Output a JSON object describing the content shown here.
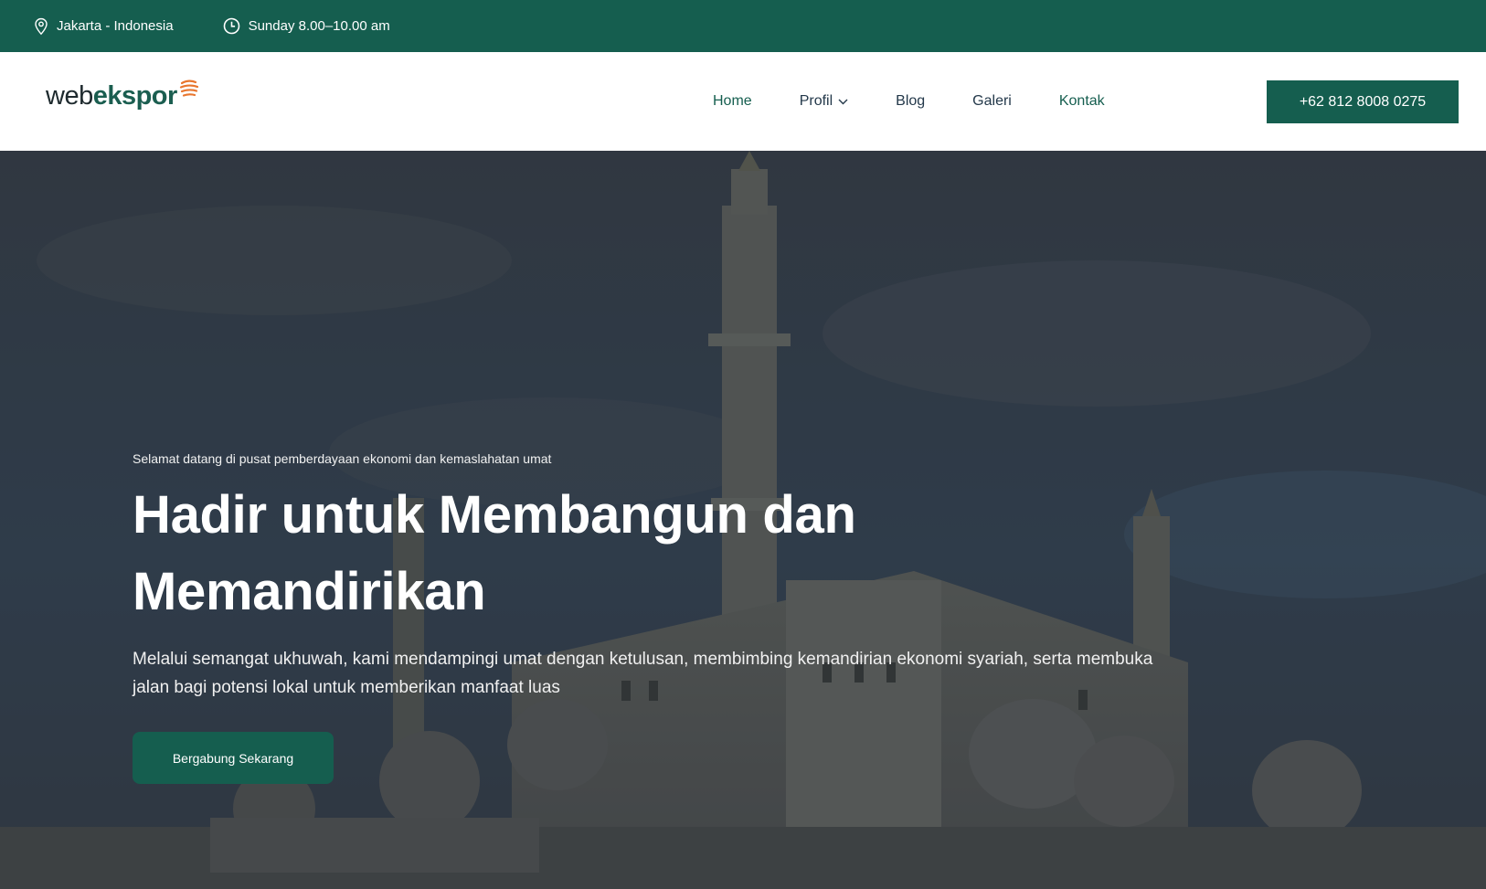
{
  "topbar": {
    "location": "Jakarta - Indonesia",
    "hours": "Sunday 8.00–10.00 am",
    "location_icon": "map-pin-icon",
    "hours_icon": "clock-icon"
  },
  "brand": {
    "logo_web": "web",
    "logo_ekspor": "ekspor"
  },
  "nav": {
    "items": [
      {
        "label": "Home"
      },
      {
        "label": "Profil"
      },
      {
        "label": "Blog"
      },
      {
        "label": "Galeri"
      },
      {
        "label": "Kontak"
      }
    ],
    "phone": "+62 812 8008 0275"
  },
  "hero": {
    "eyebrow": "Selamat datang di pusat pemberdayaan ekonomi dan kemaslahatan umat",
    "title": "Hadir untuk Membangun dan Memandirikan",
    "description": "Melalui semangat ukhuwah, kami mendampingi umat dengan ketulusan, membimbing kemandirian ekonomi syariah, serta membuka jalan bagi potensi lokal untuk memberikan manfaat luas",
    "cta": "Bergabung Sekarang"
  },
  "colors": {
    "brand_green": "#155e4f",
    "logo_accent": "#e8762e",
    "nav_text": "#23384a"
  }
}
